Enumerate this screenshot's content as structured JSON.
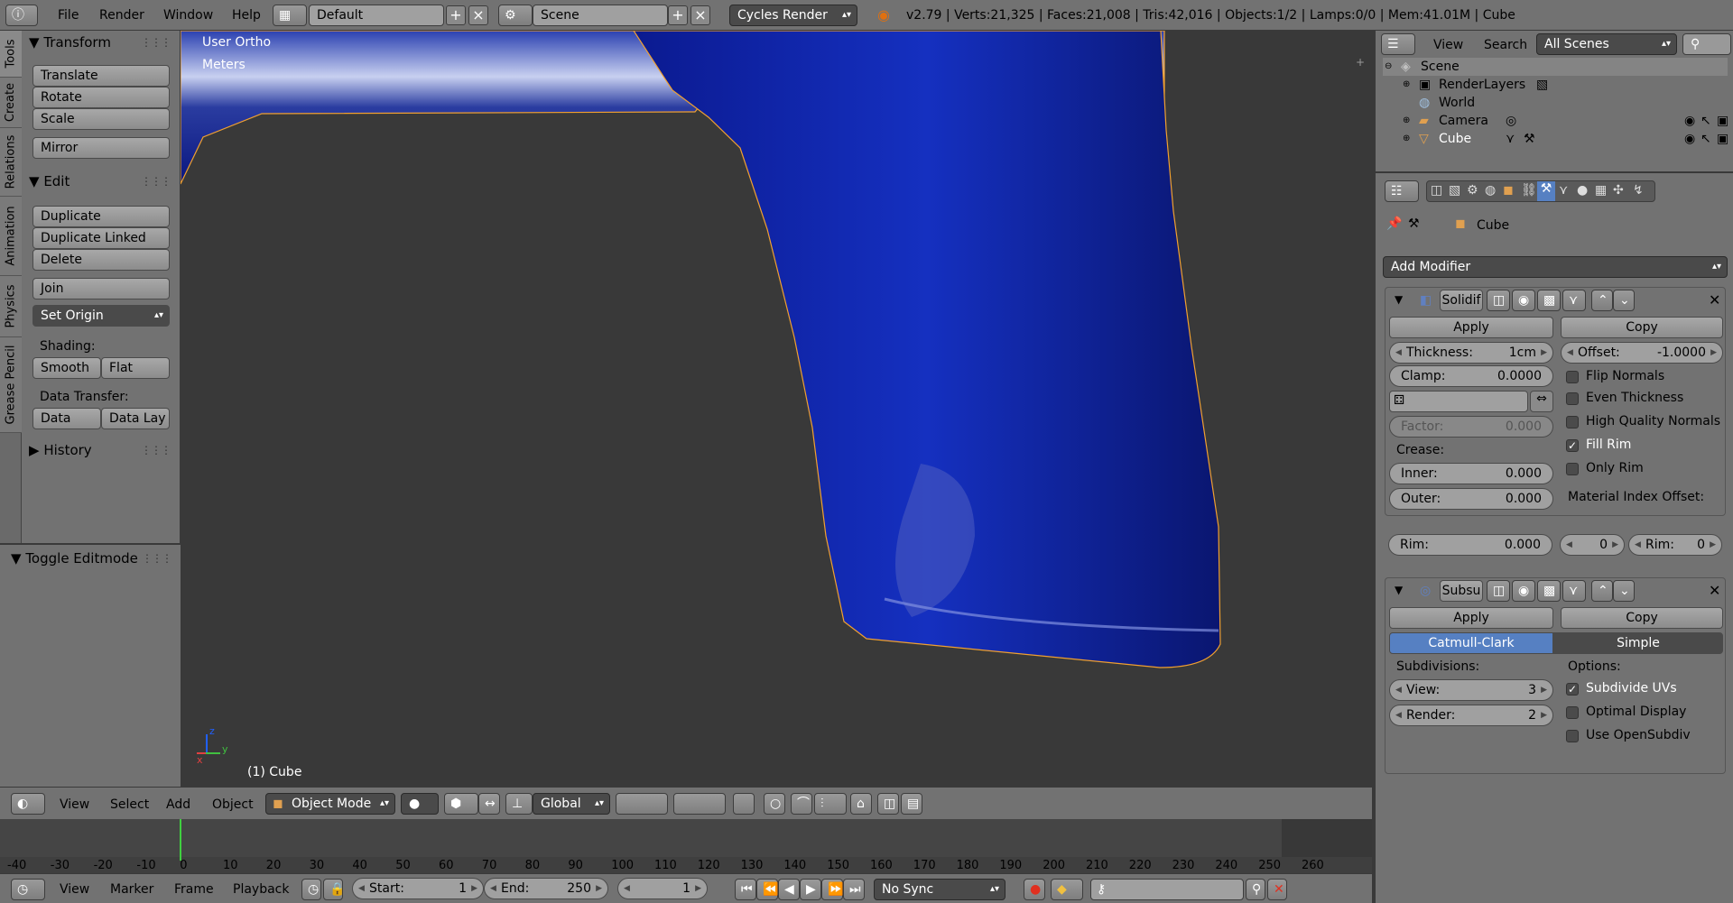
{
  "topbar": {
    "menus": [
      "File",
      "Render",
      "Window",
      "Help"
    ],
    "layout": "Default",
    "scene": "Scene",
    "engine": "Cycles Render",
    "stats": "v2.79 | Verts:21,325 | Faces:21,008 | Tris:42,016 | Objects:1/2 | Lamps:0/0 | Mem:41.01M | Cube"
  },
  "lefttabs": [
    "Tools",
    "Create",
    "Relations",
    "Animation",
    "Physics",
    "Grease Pencil"
  ],
  "toolpanel": {
    "transform_title": "Transform",
    "translate": "Translate",
    "rotate": "Rotate",
    "scale": "Scale",
    "mirror": "Mirror",
    "edit_title": "Edit",
    "duplicate": "Duplicate",
    "duplicate_linked": "Duplicate Linked",
    "delete": "Delete",
    "join": "Join",
    "set_origin": "Set Origin",
    "shading_label": "Shading:",
    "smooth": "Smooth",
    "flat": "Flat",
    "data_transfer_label": "Data Transfer:",
    "data": "Data",
    "data_lay": "Data Lay",
    "history_title": "History",
    "toggle_editmode": "Toggle Editmode"
  },
  "viewport": {
    "view_name": "User Ortho",
    "units": "Meters",
    "object_label": "(1) Cube",
    "axis_z": "z",
    "axis_y": "y",
    "axis_x": "x",
    "object_color": "#0a1a8c",
    "outline_color": "#f0a030"
  },
  "v3dheader": {
    "menus": [
      "View",
      "Select",
      "Add",
      "Object"
    ],
    "mode": "Object Mode",
    "orientation": "Global"
  },
  "timeline": {
    "ticks": [
      "-40",
      "-30",
      "-20",
      "-10",
      "0",
      "10",
      "20",
      "30",
      "40",
      "50",
      "60",
      "70",
      "80",
      "90",
      "100",
      "110",
      "120",
      "130",
      "140",
      "150",
      "160",
      "170",
      "180",
      "190",
      "200",
      "210",
      "220",
      "230",
      "240",
      "250",
      "260"
    ],
    "current_frame_value": 0
  },
  "tlheader": {
    "menus": [
      "View",
      "Marker",
      "Frame",
      "Playback"
    ],
    "start_label": "Start:",
    "start_value": "1",
    "end_label": "End:",
    "end_value": "250",
    "current": "1",
    "sync": "No Sync"
  },
  "outliner": {
    "menus": [
      "View",
      "Search"
    ],
    "scope": "All Scenes",
    "rows": [
      "Scene",
      "RenderLayers",
      "World",
      "Camera",
      "Cube"
    ]
  },
  "props": {
    "object_name": "Cube",
    "add_modifier": "Add Modifier",
    "solidify": {
      "name": "Solidif",
      "apply": "Apply",
      "copy": "Copy",
      "thickness_label": "Thickness:",
      "thickness_value": "1cm",
      "offset_label": "Offset:",
      "offset_value": "-1.0000",
      "clamp_label": "Clamp:",
      "clamp_value": "0.0000",
      "flip_normals": "Flip Normals",
      "even_thickness": "Even Thickness",
      "high_quality_normals": "High Quality Normals",
      "fill_rim": "Fill Rim",
      "only_rim": "Only Rim",
      "factor_label": "Factor:",
      "factor_value": "0.000",
      "crease_label": "Crease:",
      "inner_label": "Inner:",
      "inner_value": "0.000",
      "outer_label": "Outer:",
      "outer_value": "0.000",
      "rim_label": "Rim:",
      "rim_value": "0.000",
      "mat_index_label": "Material Index Offset:",
      "mat_index_value": "0",
      "mat_rim_label": "Rim:",
      "mat_rim_value": "0"
    },
    "subsurf": {
      "name": "Subsu",
      "apply": "Apply",
      "copy": "Copy",
      "catmull": "Catmull-Clark",
      "simple": "Simple",
      "subdivisions_label": "Subdivisions:",
      "options_label": "Options:",
      "view_label": "View:",
      "view_value": "3",
      "render_label": "Render:",
      "render_value": "2",
      "subdivide_uvs": "Subdivide UVs",
      "optimal_display": "Optimal Display",
      "use_opensubdiv": "Use OpenSubdiv"
    }
  }
}
